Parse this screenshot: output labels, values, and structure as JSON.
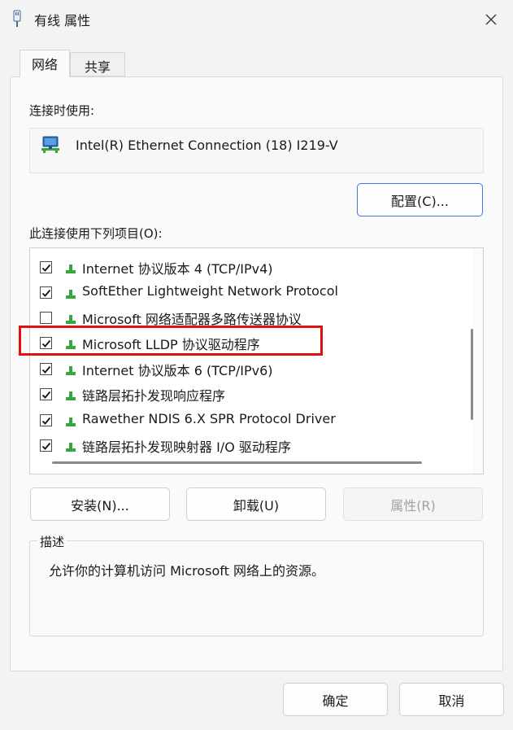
{
  "window": {
    "title": "有线 属性",
    "close_icon": "close-icon"
  },
  "tabs": [
    {
      "label": "网络",
      "active": true
    },
    {
      "label": "共享",
      "active": false
    }
  ],
  "connect_using": {
    "label": "连接时使用:",
    "adapter_name": "Intel(R) Ethernet Connection (18) I219-V",
    "adapter_icon": "network-adapter-icon"
  },
  "buttons": {
    "configure": "配置(C)...",
    "install": "安装(N)...",
    "uninstall": "卸载(U)",
    "properties": "属性(R)",
    "ok": "确定",
    "cancel": "取消"
  },
  "items_label": "此连接使用下列项目(O):",
  "items": [
    {
      "label": "Internet 协议版本 4 (TCP/IPv4)",
      "checked": true
    },
    {
      "label": "SoftEther Lightweight Network Protocol",
      "checked": true
    },
    {
      "label": "Microsoft 网络适配器多路传送器协议",
      "checked": false
    },
    {
      "label": "Microsoft LLDP 协议驱动程序",
      "checked": true
    },
    {
      "label": "Internet 协议版本 6 (TCP/IPv6)",
      "checked": true
    },
    {
      "label": "链路层拓扑发现响应程序",
      "checked": true
    },
    {
      "label": "Rawether NDIS 6.X SPR Protocol Driver",
      "checked": true
    },
    {
      "label": "链路层拓扑发现映射器 I/O 驱动程序",
      "checked": true
    }
  ],
  "description": {
    "legend": "描述",
    "text": "允许你的计算机访问 Microsoft 网络上的资源。"
  },
  "colors": {
    "accent": "#3b78d8",
    "highlight": "#e01010",
    "protocol_icon": "#3aa53a"
  }
}
